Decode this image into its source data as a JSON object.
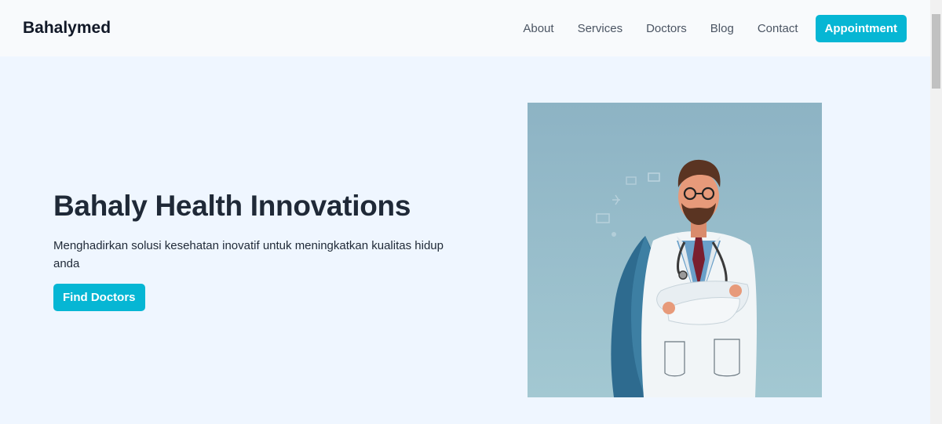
{
  "navbar": {
    "brand": "Bahalymed",
    "links": [
      "About",
      "Services",
      "Doctors",
      "Blog",
      "Contact"
    ],
    "cta": "Appointment"
  },
  "hero": {
    "title": "Bahaly Health Innovations",
    "subtitle": "Menghadirkan solusi kesehatan inovatif untuk meningkatkan kualitas hidup anda",
    "button": "Find Doctors",
    "image_icon": "doctor-illustration"
  },
  "colors": {
    "accent": "#06b6d4",
    "hero_bg": "#eff6ff",
    "nav_bg": "#f8fafc"
  }
}
